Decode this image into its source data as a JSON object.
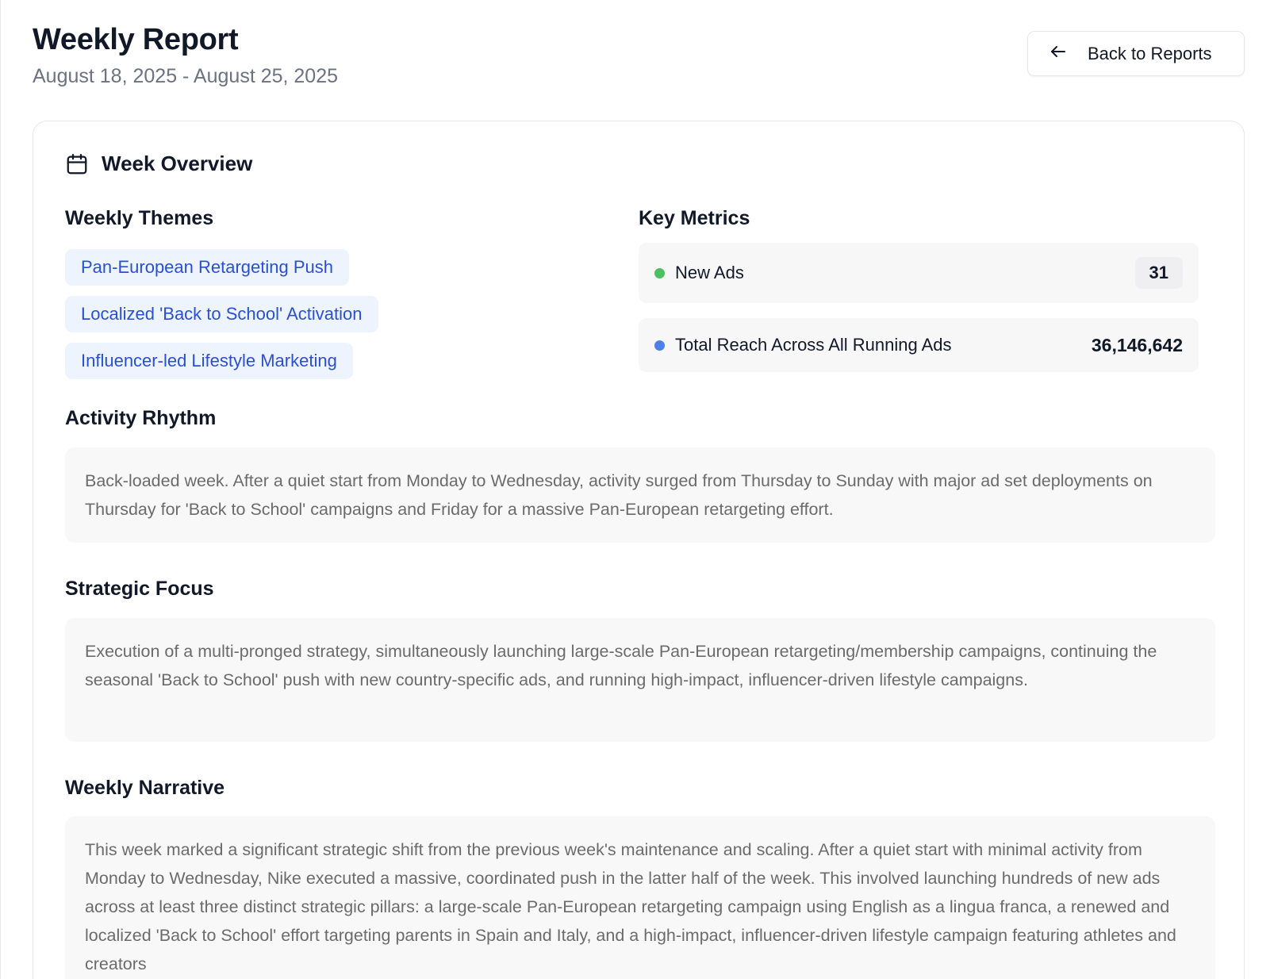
{
  "header": {
    "title": "Weekly Report",
    "date_range": "August 18, 2025 - August 25, 2025",
    "back_button_label": "Back to Reports",
    "back_icon": "arrow-left-icon"
  },
  "overview": {
    "title": "Week Overview",
    "icon": "calendar-icon",
    "themes_title": "Weekly Themes",
    "themes": [
      "Pan-European Retargeting Push",
      "Localized 'Back to School' Activation",
      "Influencer-led Lifestyle Marketing"
    ],
    "metrics_title": "Key Metrics",
    "metrics": [
      {
        "label": "New Ads",
        "value": "31",
        "dot_color": "#4cc05e"
      },
      {
        "label": "Total Reach Across All Running Ads",
        "value": "36,146,642",
        "dot_color": "#4f7fe8"
      }
    ],
    "activity_rhythm": {
      "title": "Activity Rhythm",
      "text": "Back-loaded week. After a quiet start from Monday to Wednesday, activity surged from Thursday to Sunday with major ad set deployments on Thursday for 'Back to School' campaigns and Friday for a massive Pan-European retargeting effort."
    },
    "strategic_focus": {
      "title": "Strategic Focus",
      "text": "Execution of a multi-pronged strategy, simultaneously launching large-scale Pan-European retargeting/membership campaigns, continuing the seasonal 'Back to School' push with new country-specific ads, and running high-impact, influencer-driven lifestyle campaigns."
    },
    "weekly_narrative": {
      "title": "Weekly Narrative",
      "text": "This week marked a significant strategic shift from the previous week's maintenance and scaling. After a quiet start with minimal activity from Monday to Wednesday, Nike executed a massive, coordinated push in the latter half of the week. This involved launching hundreds of new ads across at least three distinct strategic pillars: a large-scale Pan-European retargeting campaign using English as a lingua franca, a renewed and localized 'Back to School' effort targeting parents in Spain and Italy, and a high-impact, influencer-driven lifestyle campaign featuring athletes and creators"
    }
  }
}
